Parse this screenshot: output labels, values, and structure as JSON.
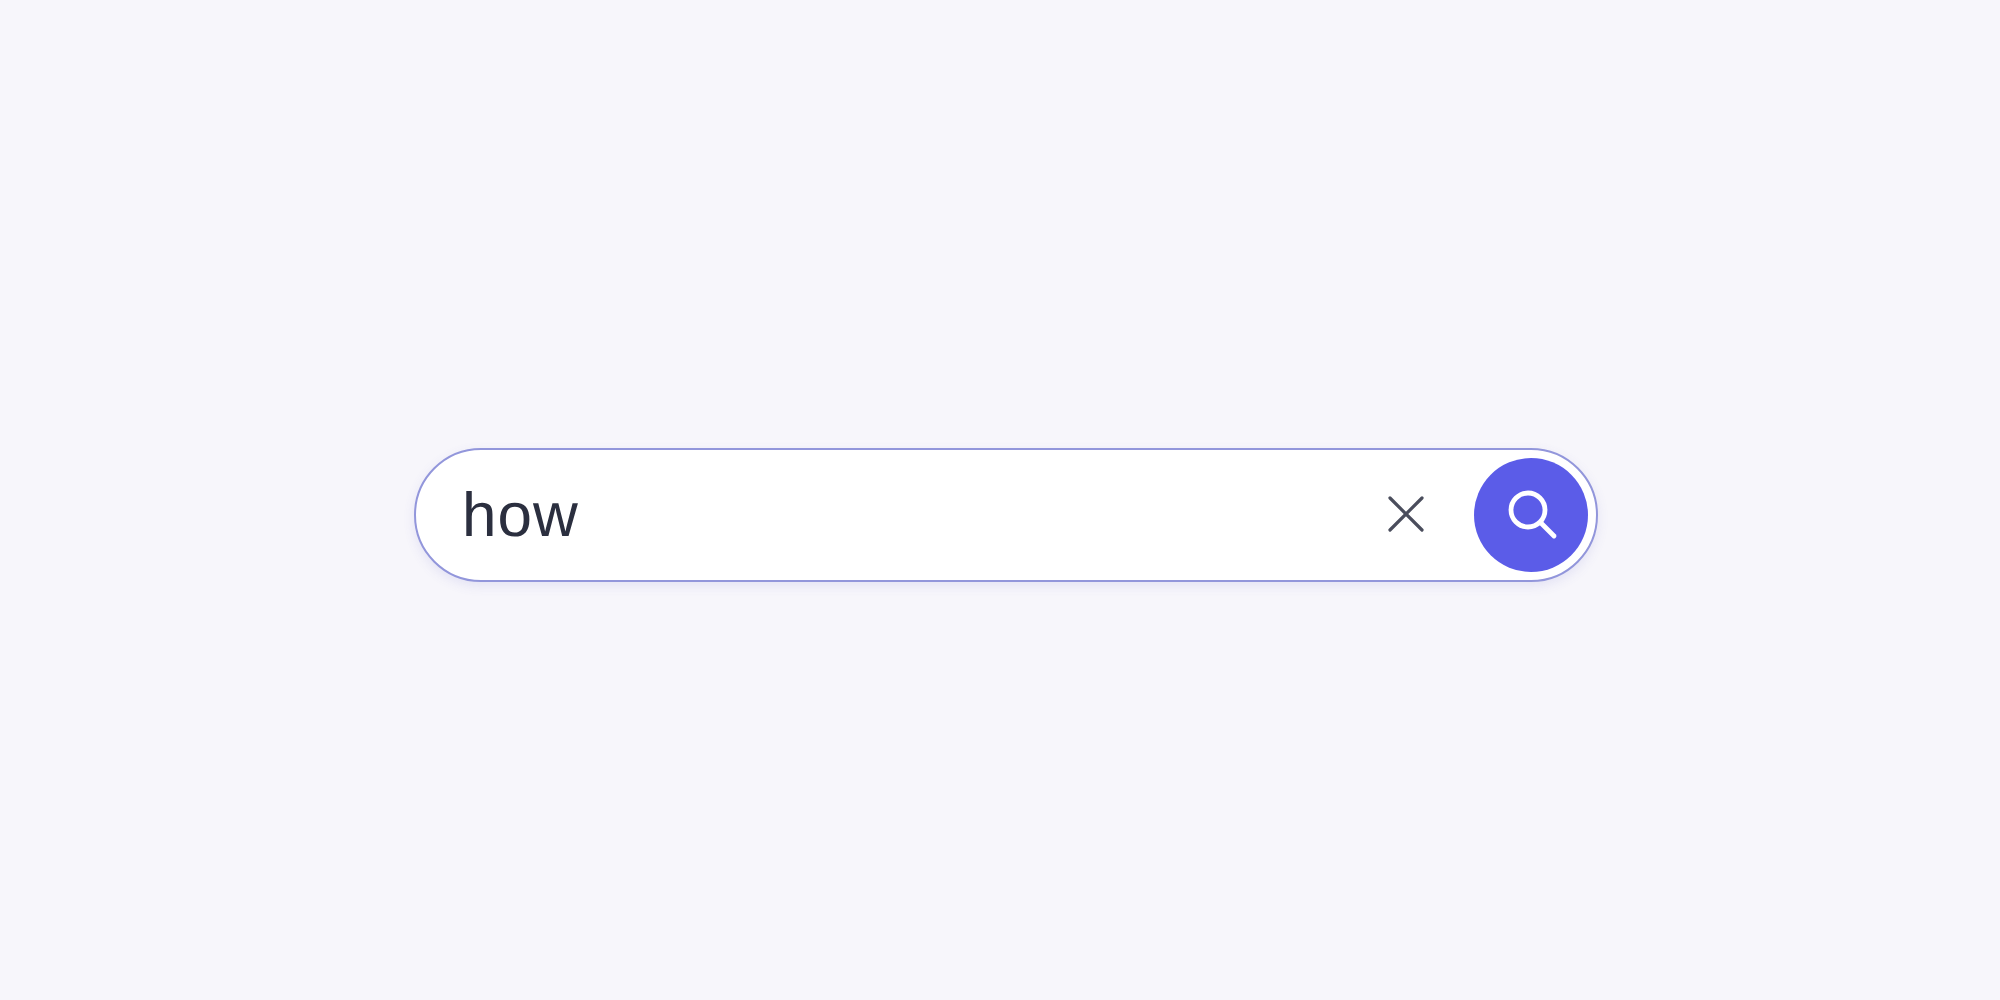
{
  "search": {
    "value": "how"
  }
}
